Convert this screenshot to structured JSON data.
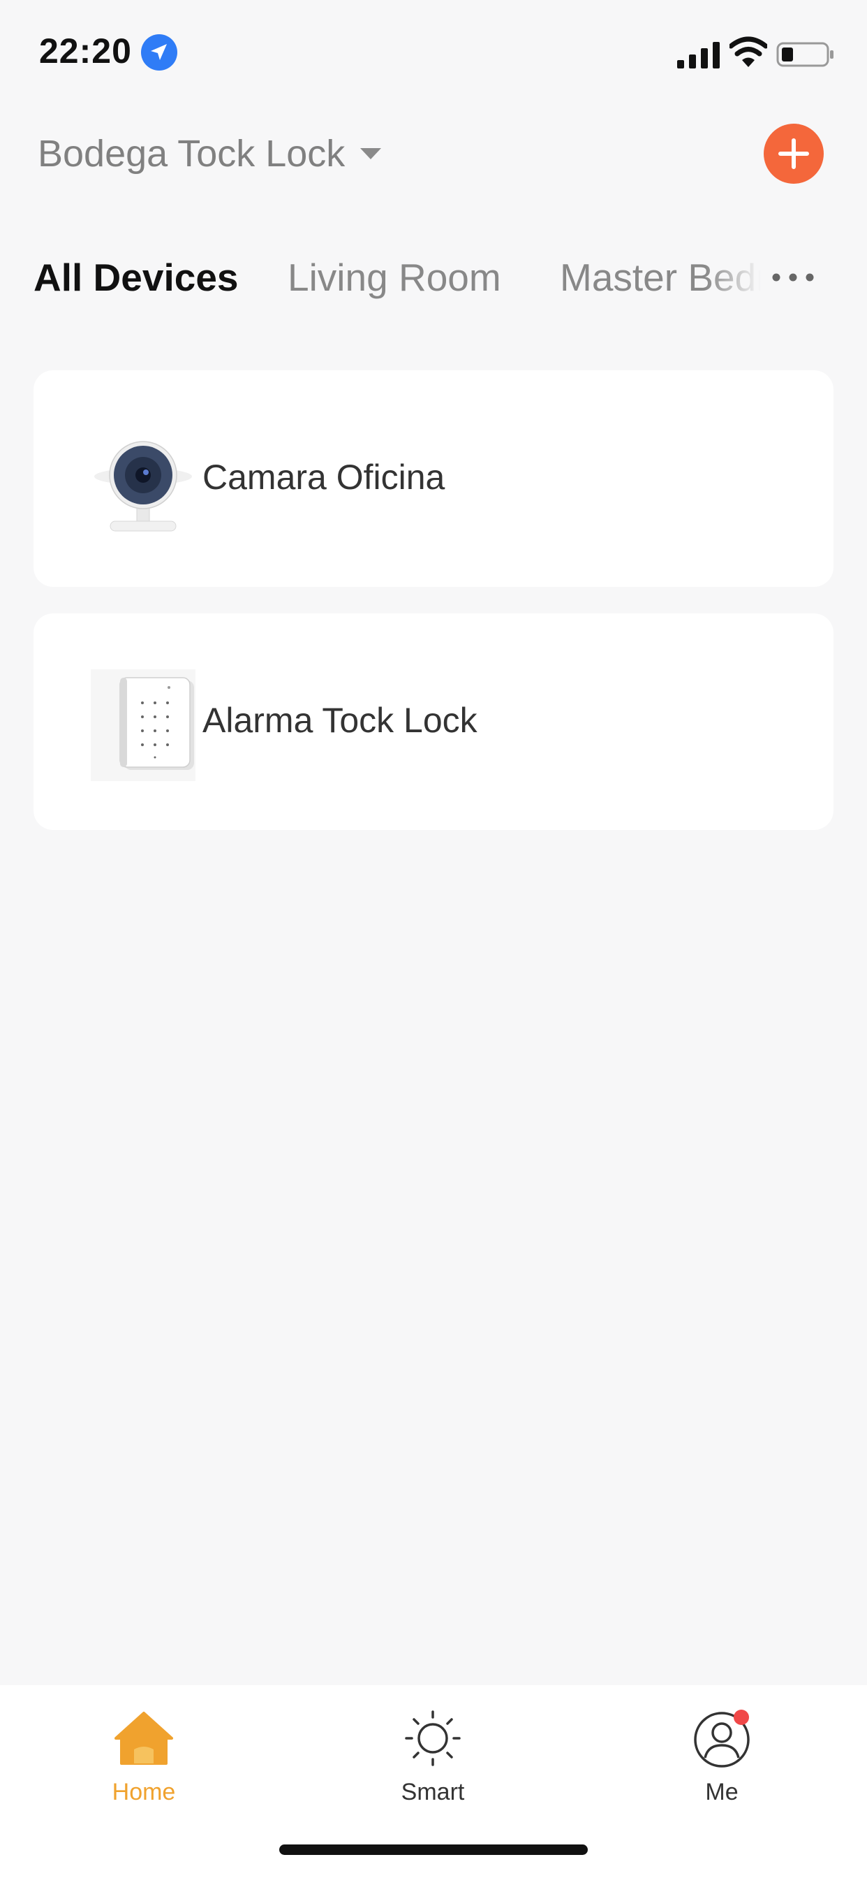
{
  "status_bar": {
    "time": "22:20",
    "icons": [
      "location-arrow-icon",
      "cell-signal-icon",
      "wifi-icon",
      "battery-icon"
    ]
  },
  "header": {
    "home_name": "Bodega Tock Lock",
    "add_icon": "plus-icon",
    "accent_color": "#f4673b"
  },
  "tabs": {
    "items": [
      {
        "label": "All Devices",
        "active": true
      },
      {
        "label": "Living Room",
        "active": false
      },
      {
        "label": "Master Bedroom",
        "active": false
      }
    ],
    "more_icon": "more-dots-icon"
  },
  "devices": [
    {
      "name": "Camara Oficina",
      "icon": "camera-device-icon"
    },
    {
      "name": "Alarma Tock Lock",
      "icon": "alarm-keypad-icon"
    }
  ],
  "bottom_nav": {
    "items": [
      {
        "label": "Home",
        "icon": "home-icon",
        "active": true
      },
      {
        "label": "Smart",
        "icon": "sun-icon",
        "active": false
      },
      {
        "label": "Me",
        "icon": "user-icon",
        "active": false,
        "badge": true
      }
    ],
    "active_color": "#f0a22e",
    "badge_color": "#f04848"
  }
}
